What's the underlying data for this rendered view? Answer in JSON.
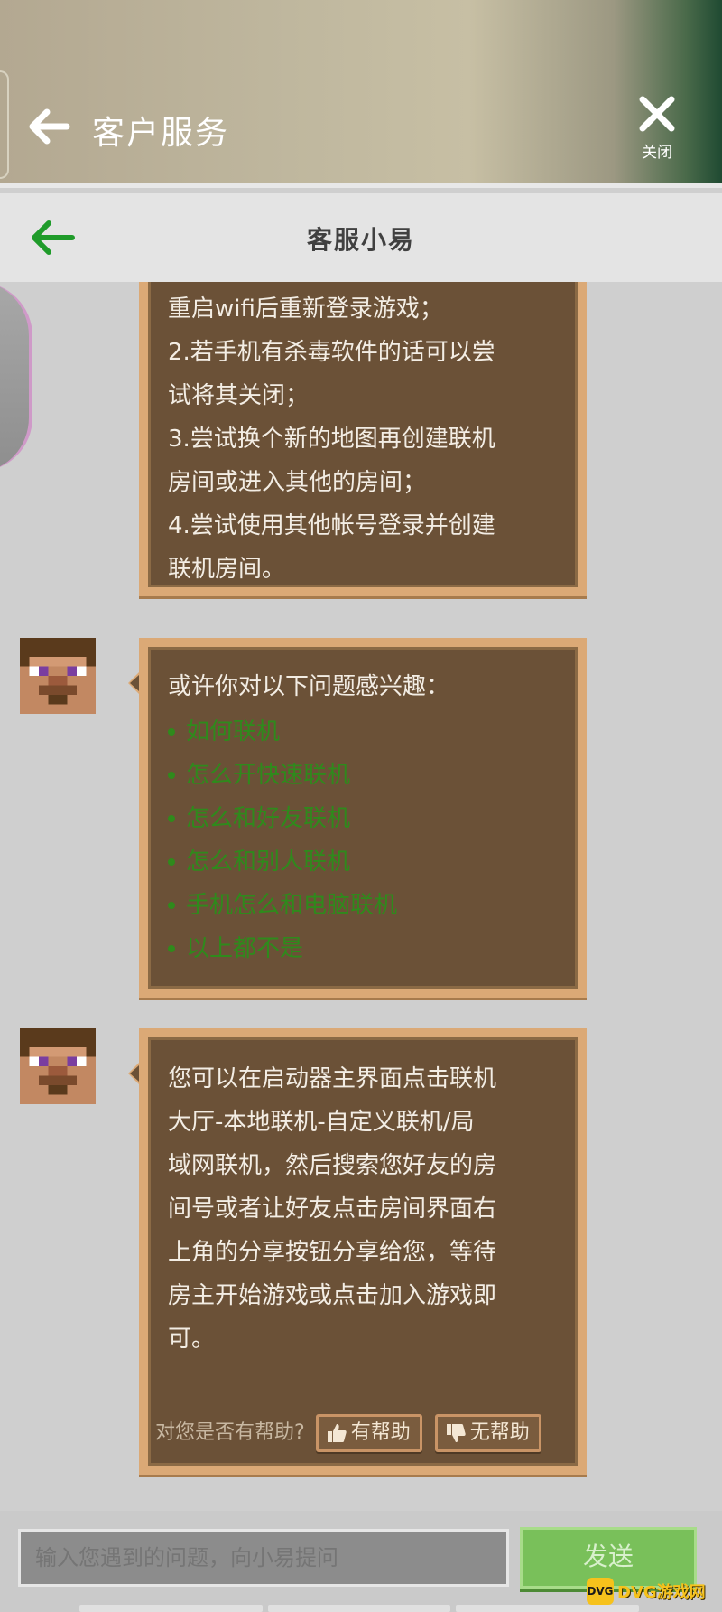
{
  "top_bar": {
    "title": "客户服务",
    "close_label": "关闭"
  },
  "sub_header": {
    "title": "客服小易"
  },
  "messages": {
    "msg1": {
      "lines": [
        "重启wifi后重新登录游戏；",
        "2.若手机有杀毒软件的话可以尝",
        "试将其关闭；",
        "3.尝试换个新的地图再创建联机",
        "房间或进入其他的房间；",
        "4.尝试使用其他帐号登录并创建",
        "联机房间。"
      ]
    },
    "msg2": {
      "intro": "或许你对以下问题感兴趣：",
      "suggestions": [
        "如何联机",
        "怎么开快速联机",
        "怎么和好友联机",
        "怎么和别人联机",
        "手机怎么和电脑联机",
        "以上都不是"
      ]
    },
    "msg3": {
      "lines": [
        "您可以在启动器主界面点击联机",
        "大厅-本地联机-自定义联机/局",
        "域网联机，然后搜索您好友的房",
        "间号或者让好友点击房间界面右",
        "上角的分享按钮分享给您，等待",
        "房主开始游戏或点击加入游戏即",
        "可。"
      ],
      "feedback_question": "对您是否有帮助?",
      "helpful_label": "有帮助",
      "unhelpful_label": "无帮助"
    }
  },
  "input": {
    "placeholder": "输入您遇到的问题，向小易提问",
    "send_label": "发送"
  },
  "watermark": {
    "logo_text": "DVG",
    "text": "DVG游戏网"
  },
  "colors": {
    "bubble_bg": "#6b5137",
    "bubble_border": "#dba976",
    "suggestion_green": "#2f8a1c",
    "send_green": "#79c05a",
    "back_arrow_green": "#1f9b2a"
  }
}
